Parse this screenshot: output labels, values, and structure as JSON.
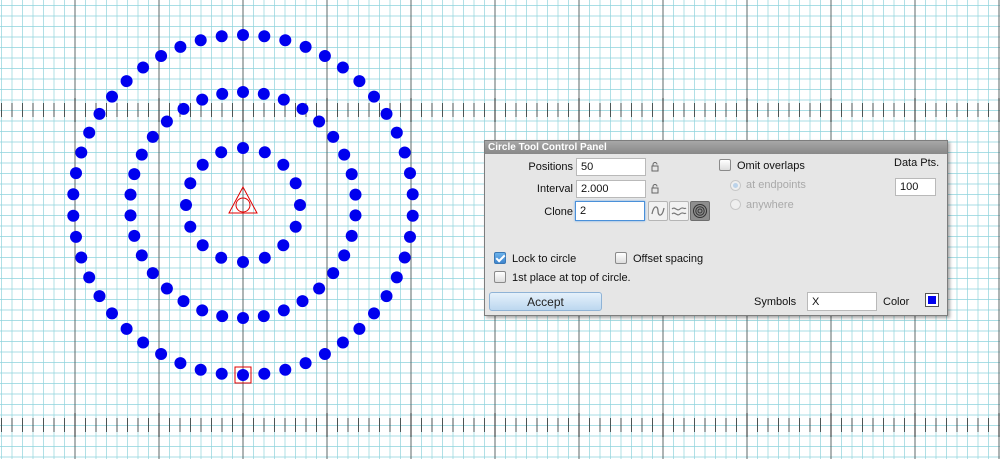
{
  "canvas": {
    "grid_minor_color": "#8ed3dc",
    "grid_major_color": "#4a4a4a",
    "dot_color": "#0000ee",
    "marker_color": "#e00000"
  },
  "panel": {
    "title": "Circle Tool Control Panel",
    "positions_label": "Positions",
    "positions_value": "50",
    "interval_label": "Interval",
    "interval_value": "2.000",
    "clone_label": "Clone",
    "clone_value": "2",
    "omit_overlaps_label": "Omit overlaps",
    "omit_overlaps_checked": false,
    "at_endpoints_label": "at endpoints",
    "anywhere_label": "anywhere",
    "data_pts_label": "Data Pts.",
    "data_pts_value": "100",
    "lock_to_circle_label": "Lock to circle",
    "lock_to_circle_checked": true,
    "offset_spacing_label": "Offset spacing",
    "offset_spacing_checked": false,
    "first_place_label": "1st place at top of circle.",
    "first_place_checked": false,
    "accept_label": "Accept",
    "symbols_label": "Symbols",
    "symbols_value": "X",
    "color_label": "Color",
    "color_value": "#0000ee",
    "icons": [
      "lock-icon",
      "wave-icon",
      "double-wave-icon",
      "concentric-circles-icon"
    ]
  }
}
